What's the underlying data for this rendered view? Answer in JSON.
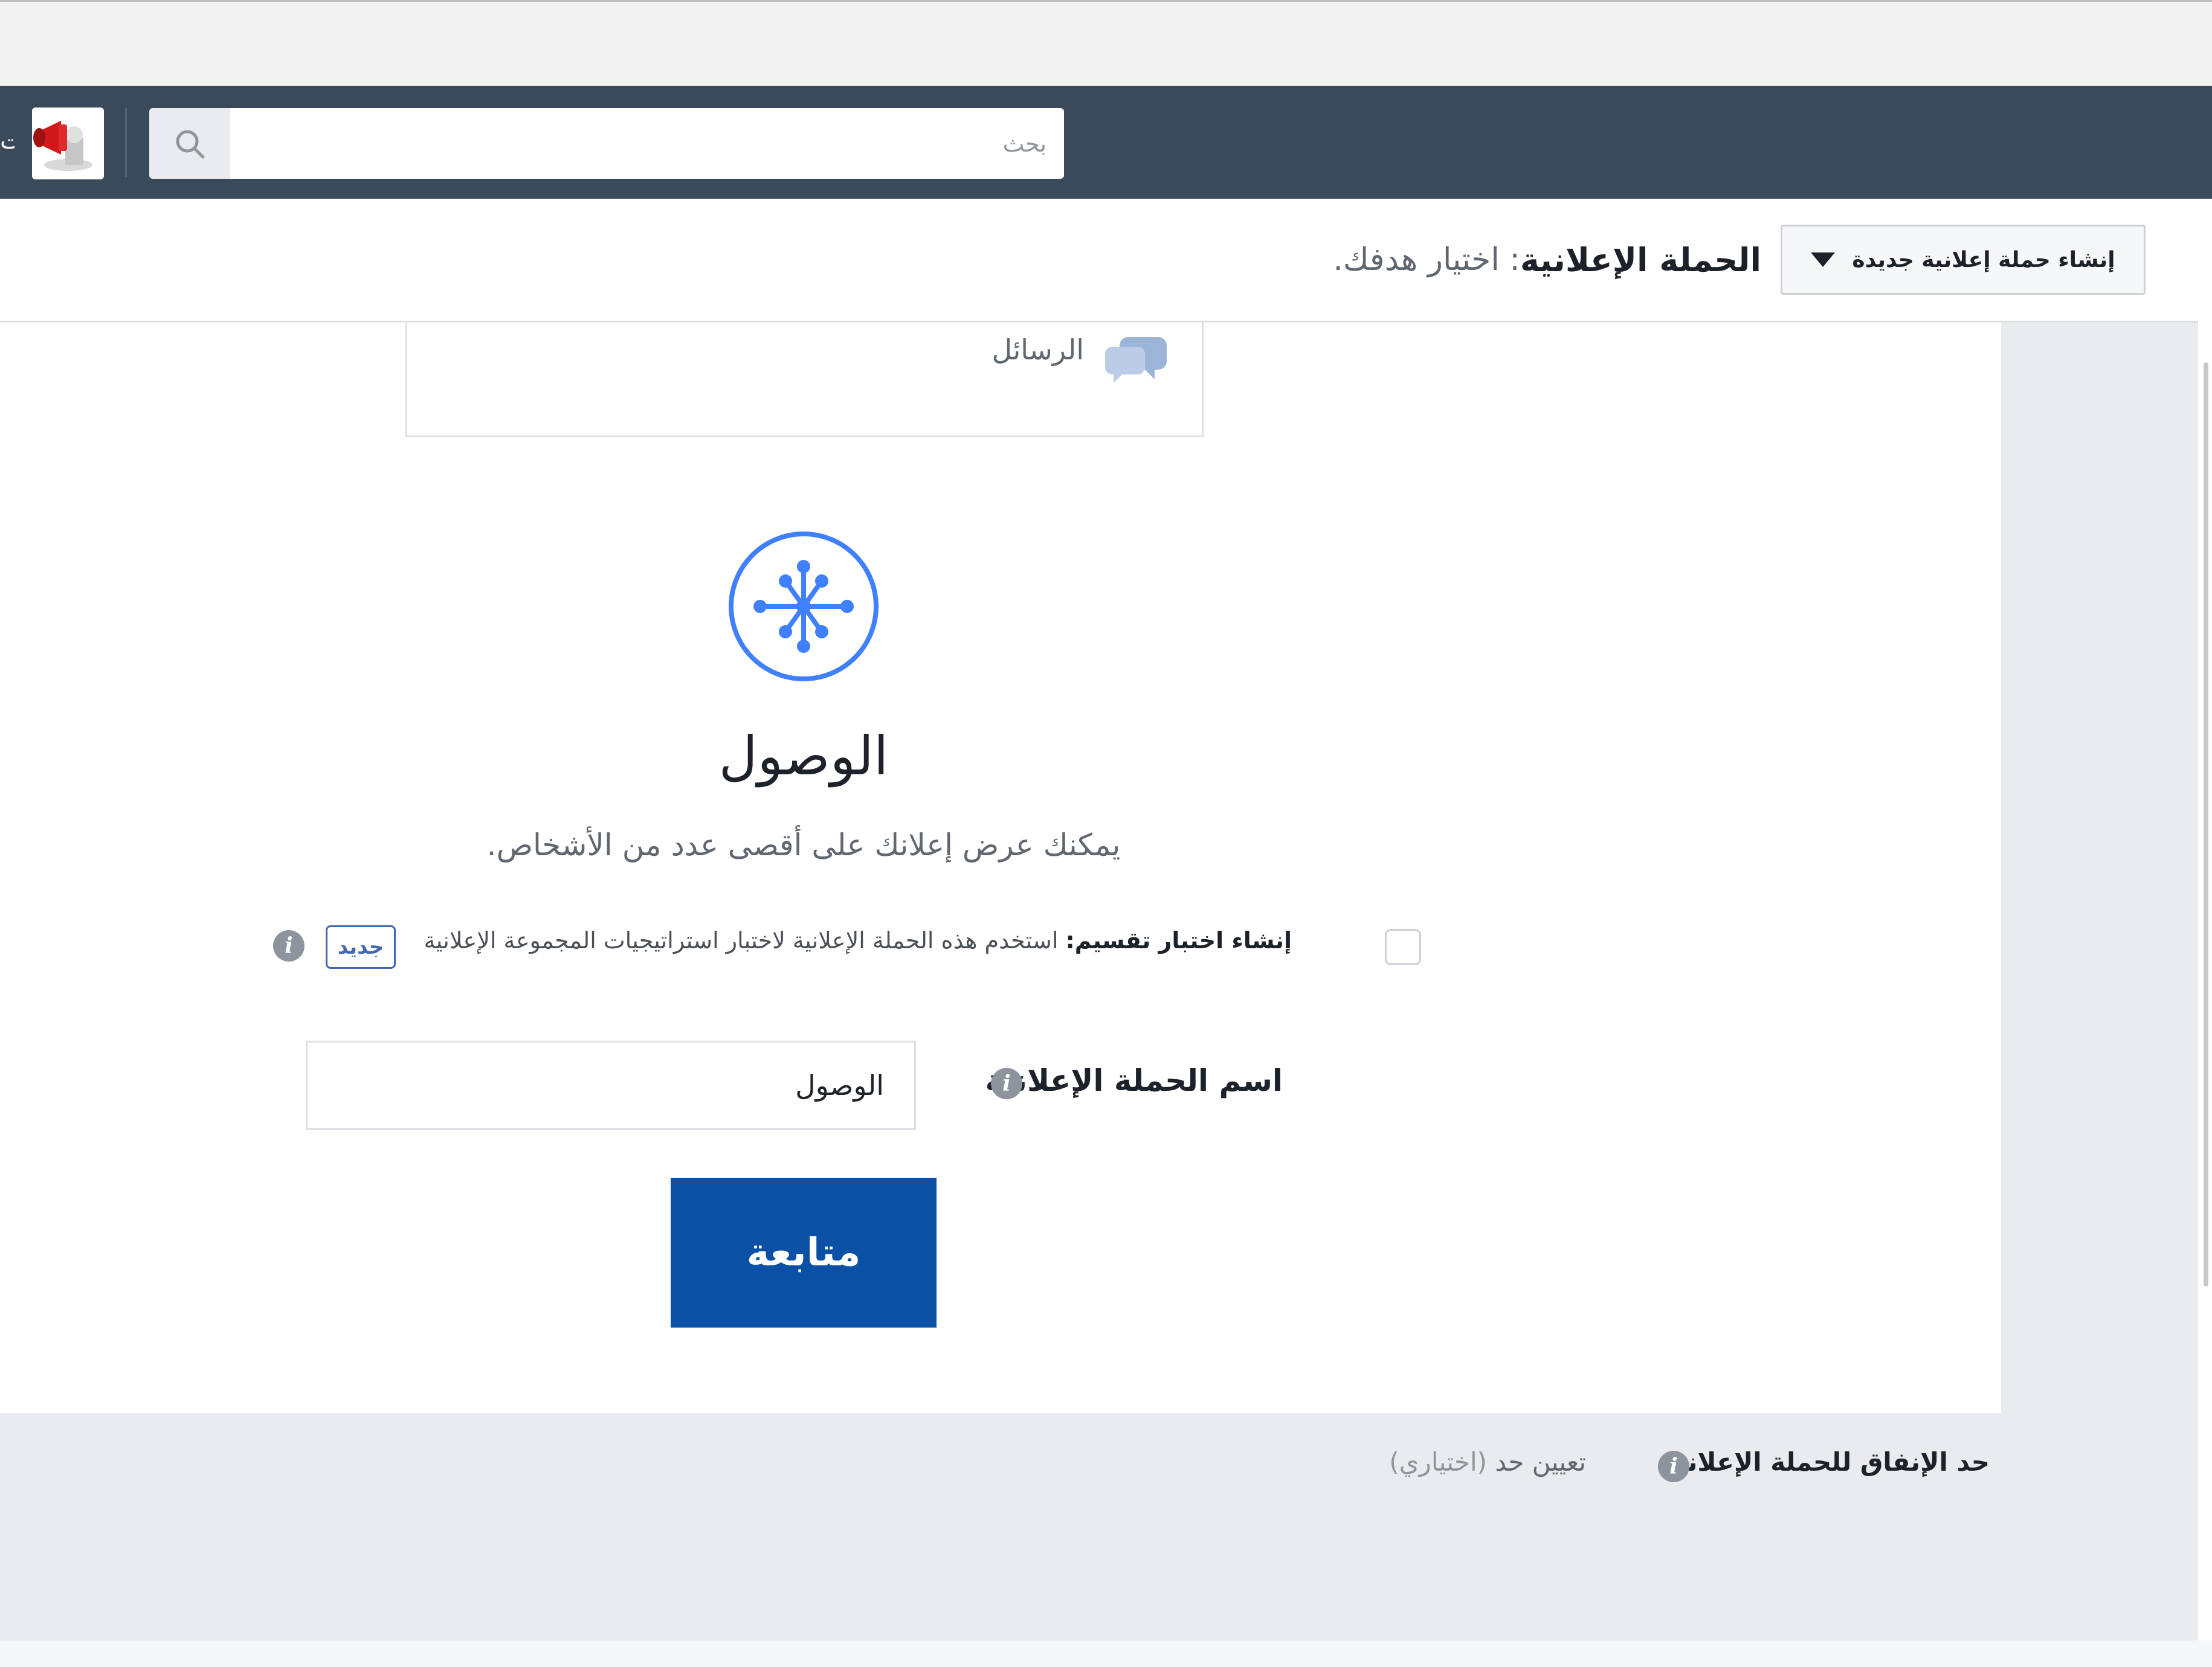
{
  "navbar": {
    "search_placeholder": "بحث",
    "cut_text": "ت"
  },
  "header": {
    "create_button_label": "إنشاء حملة إعلانية جديدة",
    "title_bold": "الحملة الإعلانية",
    "title_light": ": اختيار هدفك."
  },
  "objectives": {
    "messages_label": "الرسائل",
    "selected_title": "الوصول",
    "selected_description": "يمكنك عرض إعلانك على أقصى عدد من الأشخاص."
  },
  "split_test": {
    "bold": "إنشاء اختبار تقسيم:",
    "text": " استخدم هذه الحملة الإعلانية لاختبار استراتيجيات المجموعة الإعلانية",
    "badge": "جديد",
    "checked": false
  },
  "campaign_name": {
    "label": "اسم الحملة الإعلانية",
    "value": "الوصول"
  },
  "continue_label": "متابعة",
  "spending_limit": {
    "label": "حد الإنفاق للحملة الإعلانية",
    "link": "تعيين حد",
    "optional": " (اختياري)"
  },
  "colors": {
    "navbar": "#3b4a5b",
    "accent_blue": "#0a50a4",
    "icon_blue": "#4080ff"
  }
}
